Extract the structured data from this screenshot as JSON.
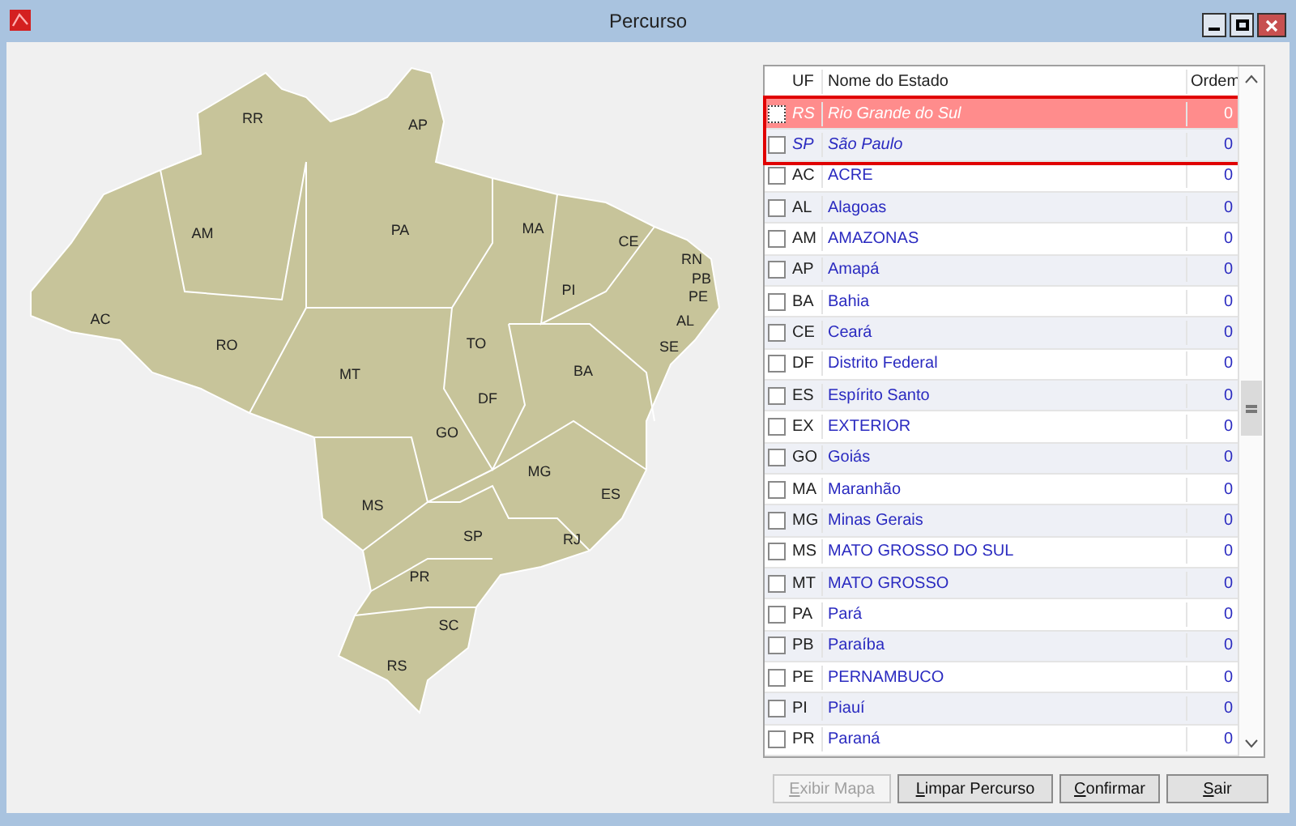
{
  "window": {
    "title": "Percurso"
  },
  "map": {
    "labels": [
      "RR",
      "AP",
      "AM",
      "PA",
      "MA",
      "CE",
      "RN",
      "PB",
      "PE",
      "AL",
      "SE",
      "PI",
      "AC",
      "RO",
      "TO",
      "BA",
      "MT",
      "DF",
      "GO",
      "MG",
      "ES",
      "MS",
      "SP",
      "RJ",
      "PR",
      "SC",
      "RS"
    ]
  },
  "table": {
    "columns": [
      "UF",
      "Nome do Estado",
      "Ordem"
    ],
    "rows": [
      {
        "uf": "RS",
        "name": "Rio Grande do Sul",
        "order": "0",
        "checked": false,
        "selected": true,
        "in_route": true
      },
      {
        "uf": "SP",
        "name": "São Paulo",
        "order": "0",
        "checked": false,
        "selected": false,
        "in_route": true
      },
      {
        "uf": "AC",
        "name": "ACRE",
        "order": "0",
        "checked": false,
        "selected": false,
        "in_route": false
      },
      {
        "uf": "AL",
        "name": "Alagoas",
        "order": "0",
        "checked": false,
        "selected": false,
        "in_route": false
      },
      {
        "uf": "AM",
        "name": "AMAZONAS",
        "order": "0",
        "checked": false,
        "selected": false,
        "in_route": false
      },
      {
        "uf": "AP",
        "name": "Amapá",
        "order": "0",
        "checked": false,
        "selected": false,
        "in_route": false
      },
      {
        "uf": "BA",
        "name": "Bahia",
        "order": "0",
        "checked": false,
        "selected": false,
        "in_route": false
      },
      {
        "uf": "CE",
        "name": "Ceará",
        "order": "0",
        "checked": false,
        "selected": false,
        "in_route": false
      },
      {
        "uf": "DF",
        "name": "Distrito Federal",
        "order": "0",
        "checked": false,
        "selected": false,
        "in_route": false
      },
      {
        "uf": "ES",
        "name": "Espírito Santo",
        "order": "0",
        "checked": false,
        "selected": false,
        "in_route": false
      },
      {
        "uf": "EX",
        "name": "EXTERIOR",
        "order": "0",
        "checked": false,
        "selected": false,
        "in_route": false
      },
      {
        "uf": "GO",
        "name": "Goiás",
        "order": "0",
        "checked": false,
        "selected": false,
        "in_route": false
      },
      {
        "uf": "MA",
        "name": "Maranhão",
        "order": "0",
        "checked": false,
        "selected": false,
        "in_route": false
      },
      {
        "uf": "MG",
        "name": "Minas Gerais",
        "order": "0",
        "checked": false,
        "selected": false,
        "in_route": false
      },
      {
        "uf": "MS",
        "name": "MATO GROSSO DO SUL",
        "order": "0",
        "checked": false,
        "selected": false,
        "in_route": false
      },
      {
        "uf": "MT",
        "name": "MATO GROSSO",
        "order": "0",
        "checked": false,
        "selected": false,
        "in_route": false
      },
      {
        "uf": "PA",
        "name": "Pará",
        "order": "0",
        "checked": false,
        "selected": false,
        "in_route": false
      },
      {
        "uf": "PB",
        "name": "Paraíba",
        "order": "0",
        "checked": false,
        "selected": false,
        "in_route": false
      },
      {
        "uf": "PE",
        "name": "PERNAMBUCO",
        "order": "0",
        "checked": false,
        "selected": false,
        "in_route": false
      },
      {
        "uf": "PI",
        "name": "Piauí",
        "order": "0",
        "checked": false,
        "selected": false,
        "in_route": false
      },
      {
        "uf": "PR",
        "name": "Paraná",
        "order": "0",
        "checked": false,
        "selected": false,
        "in_route": false
      }
    ]
  },
  "buttons": [
    {
      "label": "Exibir Mapa",
      "disabled": true
    },
    {
      "label": "Limpar Percurso",
      "disabled": false
    },
    {
      "label": "Confirmar",
      "disabled": false
    },
    {
      "label": "Sair",
      "disabled": false
    }
  ]
}
